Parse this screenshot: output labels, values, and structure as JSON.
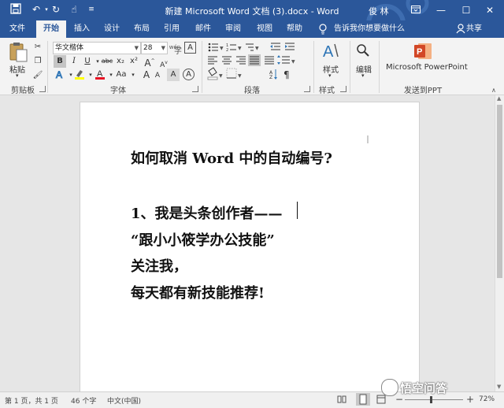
{
  "title_bar": {
    "doc_title": "新建 Microsoft Word 文档 (3).docx  -  Word",
    "user": "俊 林",
    "qat_icons": [
      "save-icon",
      "undo-icon",
      "redo-icon",
      "touch-mode-icon",
      "customize-icon"
    ]
  },
  "tabs": [
    "文件",
    "开始",
    "插入",
    "设计",
    "布局",
    "引用",
    "邮件",
    "审阅",
    "视图",
    "帮助"
  ],
  "active_tab": "开始",
  "tell_me": "告诉我你想要做什么",
  "share": "共享",
  "ribbon": {
    "clipboard": {
      "paste": "粘贴",
      "label": "剪贴板"
    },
    "font": {
      "font_name": "华文楷体",
      "font_size": "28",
      "label": "字体",
      "format_buttons": [
        "B",
        "I",
        "U",
        "abc",
        "x₂",
        "x²"
      ],
      "change_case": "Aa",
      "grow_font": "A",
      "shrink_font": "A",
      "wen": "wén",
      "char_border": "A",
      "char_shading": "A",
      "circled": "A",
      "phonetic": "字"
    },
    "paragraph": {
      "label": "段落"
    },
    "styles": {
      "button": "样式",
      "label": "样式"
    },
    "editing": {
      "button": "编辑"
    },
    "send_ppt": {
      "button": "Microsoft PowerPoint",
      "label": "发送到PPT"
    }
  },
  "document": {
    "lines": [
      "如何取消 Word 中的自动编号?",
      "1、我是头条创作者——",
      "“跟小小筱学办公技能”",
      "关注我，",
      "每天都有新技能推荐!"
    ]
  },
  "status_bar": {
    "page": "第 1 页，共 1 页",
    "words": "46 个字",
    "language": "中文(中国)",
    "zoom": "72%",
    "zoom_minus": "−",
    "zoom_plus": "+"
  },
  "watermark": "悟空问答",
  "colors": {
    "title_bar": "#2b579a",
    "ribbon": "#f3f3f3",
    "highlight": "#ffff00",
    "font_color": "#e81123",
    "ppt_red": "#d24726"
  }
}
